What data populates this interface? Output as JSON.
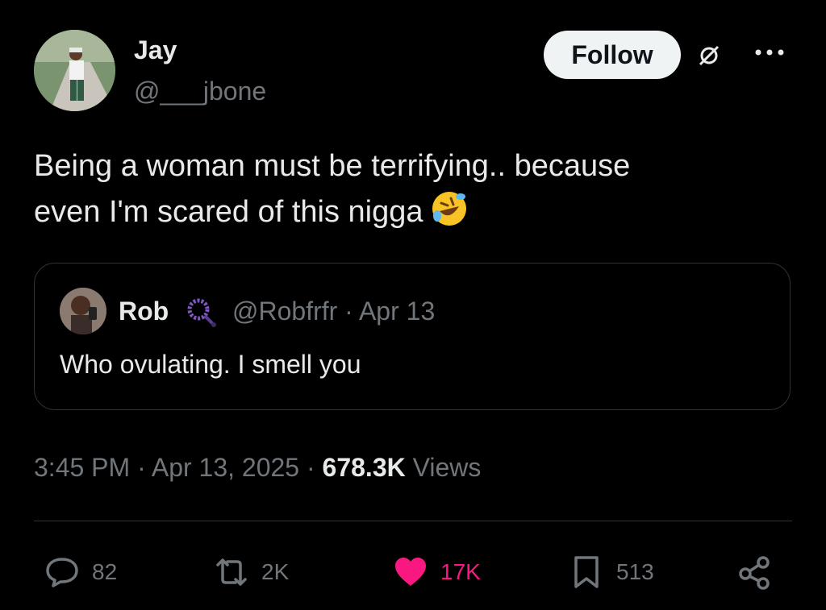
{
  "author": {
    "name": "Jay",
    "handle": "@___jbone"
  },
  "header": {
    "follow_label": "Follow"
  },
  "tweet": {
    "lines": [
      "Being a woman must be terrifying.. because",
      "even I'm scared of this nigga"
    ],
    "emoji": "rolling-on-floor-laughing"
  },
  "quote": {
    "name": "Rob",
    "handle": "@Robfrfr",
    "date": "Apr 13",
    "separator": "·",
    "text": "Who ovulating. I smell you"
  },
  "meta": {
    "time": "3:45 PM",
    "date": "Apr 13, 2025",
    "views_count": "678.3K",
    "views_label": "Views",
    "separator": "·"
  },
  "actions": {
    "replies": "82",
    "reposts": "2K",
    "likes": "17K",
    "bookmarks": "513"
  },
  "colors": {
    "like": "#f91880",
    "muted": "#71767b",
    "text": "#e7e9ea",
    "border": "#2f3336"
  }
}
